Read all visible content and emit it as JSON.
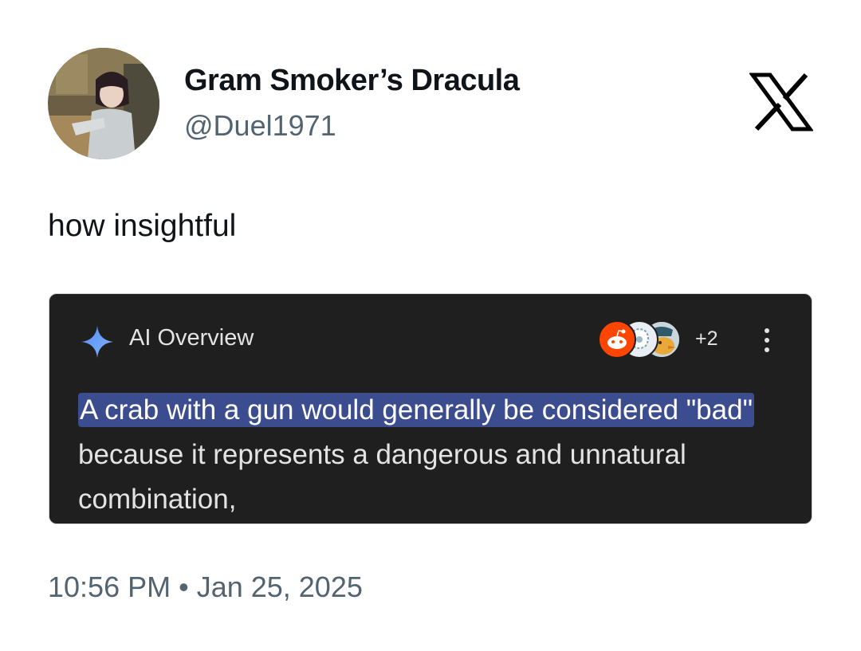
{
  "header": {
    "display_name": "Gram Smoker’s Dracula",
    "handle": "@Duel1971",
    "avatar_icon": "anime-character-avatar",
    "brand_icon": "x-logo-icon"
  },
  "tweet": {
    "text": "how insightful"
  },
  "media": {
    "title": "AI Overview",
    "title_icon": "gemini-sparkle-icon",
    "source_icons": [
      "reddit-icon",
      "source-blob-icon",
      "source-duck-icon"
    ],
    "more_sources": "+2",
    "menu_icon": "kebab-menu-icon",
    "highlighted_text": "A crab with a gun would generally be considered \"bad\"",
    "body_text": " because it represents a dangerous and unnatural combination,",
    "highlight_color": "#3b4c8f",
    "background_color": "#1f1f1f"
  },
  "footer": {
    "timestamp": "10:56 PM • Jan 25, 2025"
  }
}
